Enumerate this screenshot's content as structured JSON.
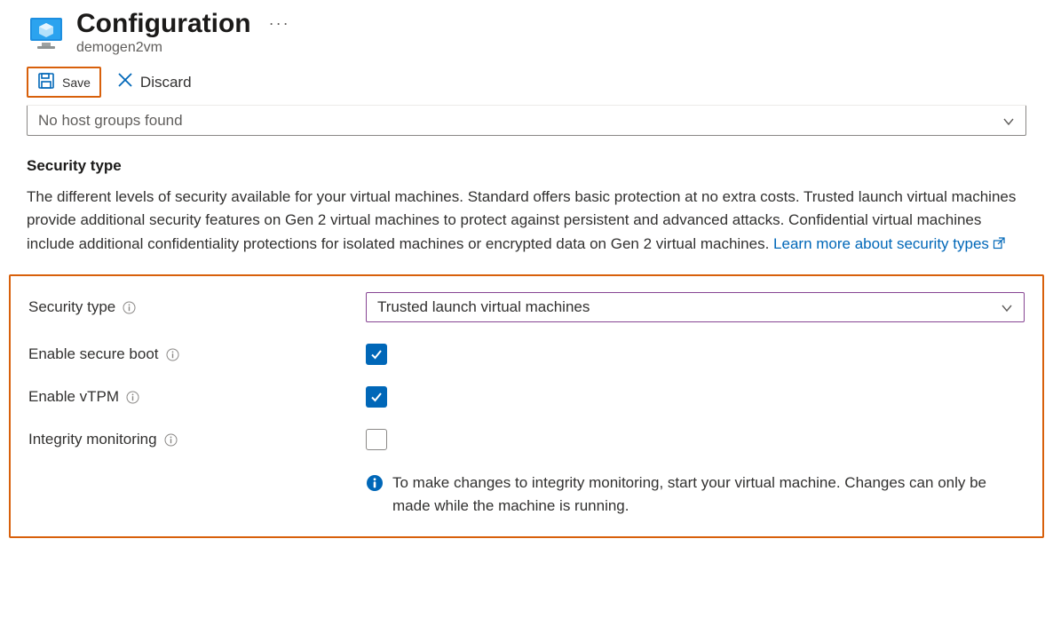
{
  "header": {
    "title": "Configuration",
    "subtitle": "demogen2vm"
  },
  "toolbar": {
    "save_label": "Save",
    "discard_label": "Discard"
  },
  "hostgroup": {
    "placeholder": "No host groups found"
  },
  "security": {
    "heading": "Security type",
    "description": "The different levels of security available for your virtual machines. Standard offers basic protection at no extra costs. Trusted launch virtual machines provide additional security features on Gen 2 virtual machines to protect against persistent and advanced attacks. Confidential virtual machines include additional confidentiality protections for isolated machines or encrypted data on Gen 2 virtual machines. ",
    "learn_more": "Learn more about security types",
    "fields": {
      "security_type": {
        "label": "Security type",
        "value": "Trusted launch virtual machines"
      },
      "secure_boot": {
        "label": "Enable secure boot",
        "checked": true
      },
      "vtpm": {
        "label": "Enable vTPM",
        "checked": true
      },
      "integrity": {
        "label": "Integrity monitoring",
        "checked": false
      }
    },
    "info_note": "To make changes to integrity monitoring, start your virtual machine. Changes can only be made while the machine is running."
  }
}
